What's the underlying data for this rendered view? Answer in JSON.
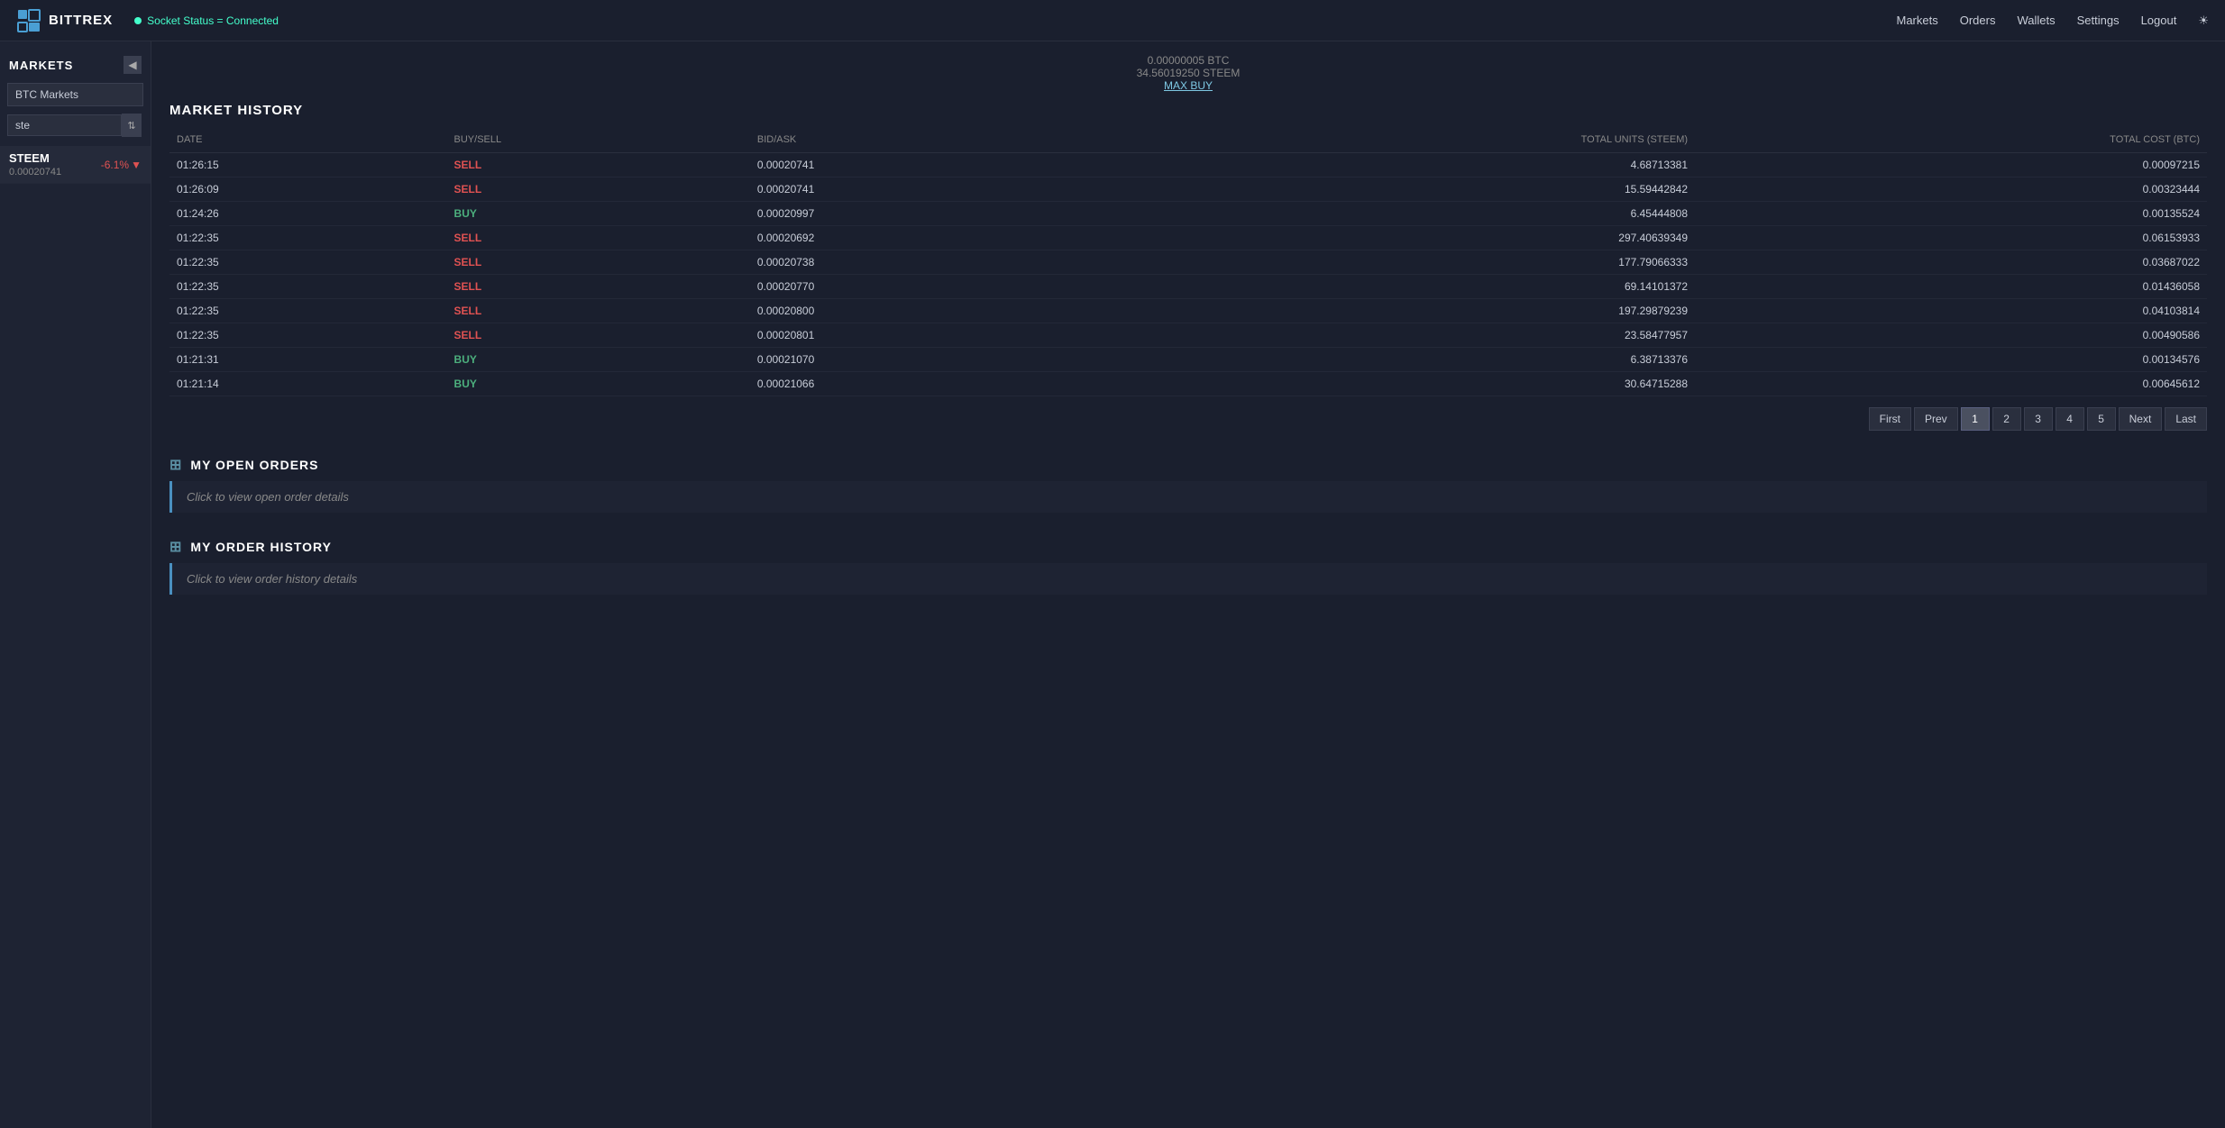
{
  "app": {
    "name": "BITTREX",
    "logo_chars": "BX"
  },
  "nav": {
    "socket_status": "Socket Status = Connected",
    "links": [
      "Markets",
      "Orders",
      "Wallets",
      "Settings",
      "Logout"
    ]
  },
  "sidebar": {
    "title": "MARKETS",
    "market_select": "BTC Markets",
    "search_placeholder": "ste",
    "items": [
      {
        "name": "STEEM",
        "price": "0.00020741",
        "change": "-6.1%",
        "change_direction": "down"
      }
    ]
  },
  "balance": {
    "amount_btc": "0.00000005  BTC",
    "amount_steem": "34.56019250  STEEM",
    "max_buy": "MAX BUY"
  },
  "market_history": {
    "title": "MARKET HISTORY",
    "columns": [
      "DATE",
      "BUY/SELL",
      "BID/ASK",
      "TOTAL UNITS (STEEM)",
      "TOTAL COST (BTC)"
    ],
    "rows": [
      {
        "date": "01:26:15",
        "type": "SELL",
        "bid_ask": "0.00020741",
        "units": "4.68713381",
        "cost": "0.00097215"
      },
      {
        "date": "01:26:09",
        "type": "SELL",
        "bid_ask": "0.00020741",
        "units": "15.59442842",
        "cost": "0.00323444"
      },
      {
        "date": "01:24:26",
        "type": "BUY",
        "bid_ask": "0.00020997",
        "units": "6.45444808",
        "cost": "0.00135524"
      },
      {
        "date": "01:22:35",
        "type": "SELL",
        "bid_ask": "0.00020692",
        "units": "297.40639349",
        "cost": "0.06153933"
      },
      {
        "date": "01:22:35",
        "type": "SELL",
        "bid_ask": "0.00020738",
        "units": "177.79066333",
        "cost": "0.03687022"
      },
      {
        "date": "01:22:35",
        "type": "SELL",
        "bid_ask": "0.00020770",
        "units": "69.14101372",
        "cost": "0.01436058"
      },
      {
        "date": "01:22:35",
        "type": "SELL",
        "bid_ask": "0.00020800",
        "units": "197.29879239",
        "cost": "0.04103814"
      },
      {
        "date": "01:22:35",
        "type": "SELL",
        "bid_ask": "0.00020801",
        "units": "23.58477957",
        "cost": "0.00490586"
      },
      {
        "date": "01:21:31",
        "type": "BUY",
        "bid_ask": "0.00021070",
        "units": "6.38713376",
        "cost": "0.00134576"
      },
      {
        "date": "01:21:14",
        "type": "BUY",
        "bid_ask": "0.00021066",
        "units": "30.64715288",
        "cost": "0.00645612"
      }
    ]
  },
  "pagination": {
    "first": "First",
    "prev": "Prev",
    "pages": [
      "1",
      "2",
      "3",
      "4",
      "5"
    ],
    "active_page": "1",
    "next": "Next",
    "last": "Last"
  },
  "open_orders": {
    "title": "MY OPEN ORDERS",
    "click_label": "Click to view open order details"
  },
  "order_history": {
    "title": "MY ORDER HISTORY",
    "click_label": "Click to view order history details"
  }
}
